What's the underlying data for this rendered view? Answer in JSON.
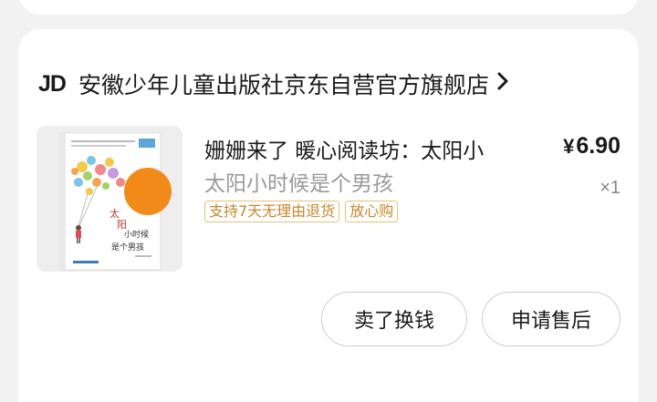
{
  "shop": {
    "logo_text": "JD",
    "name": "安徽少年儿童出版社京东自营官方旗舰店",
    "chevron": "›"
  },
  "product": {
    "title": "姗姗来了 暖心阅读坊：太阳小",
    "subtitle": "太阳小时候是个男孩",
    "price_symbol": "¥",
    "price": "6.90",
    "quantity": "×1",
    "tags": [
      "支持7天无理由退货",
      "放心购"
    ],
    "cover_title_lines": [
      "太",
      "阳",
      "小时候",
      "是个男孩"
    ]
  },
  "actions": {
    "sell_label": "卖了换钱",
    "service_label": "申请售后"
  },
  "colors": {
    "background": "#f2f2f2",
    "card": "#ffffff",
    "tag_border": "#e6c27a",
    "tag_text": "#c8882a",
    "cover_sun": "#f28a1a"
  }
}
